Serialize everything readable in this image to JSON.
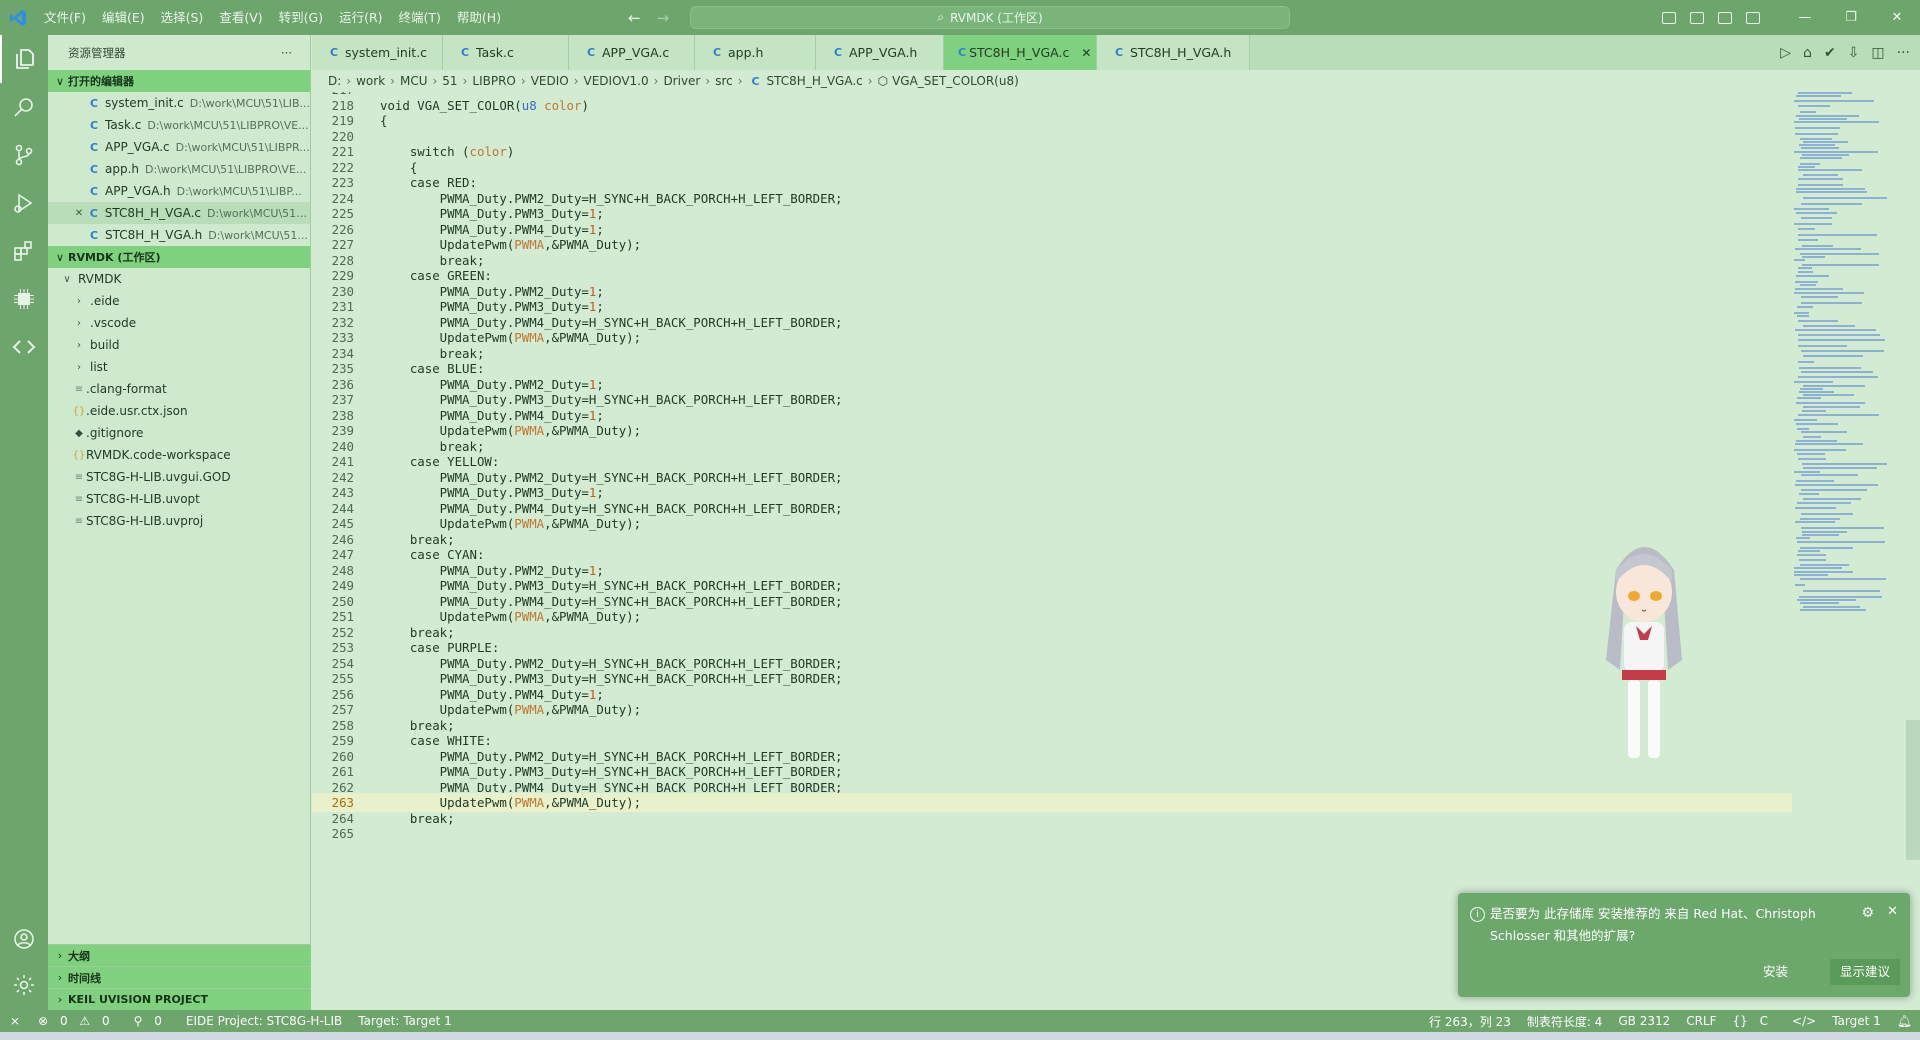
{
  "menu": [
    "文件(F)",
    "编辑(E)",
    "选择(S)",
    "查看(V)",
    "转到(G)",
    "运行(R)",
    "终端(T)",
    "帮助(H)"
  ],
  "command_center": "RVMDK (工作区)",
  "sidebar": {
    "title": "资源管理器",
    "more": "···",
    "open_editors_title": "打开的编辑器",
    "open_editors": [
      {
        "name": "system_init.c",
        "path": "D:\\work\\MCU\\51\\LIB..."
      },
      {
        "name": "Task.c",
        "path": "D:\\work\\MCU\\51\\LIBPRO\\VE..."
      },
      {
        "name": "APP_VGA.c",
        "path": "D:\\work\\MCU\\51\\LIBPR..."
      },
      {
        "name": "app.h",
        "path": "D:\\work\\MCU\\51\\LIBPRO\\VE..."
      },
      {
        "name": "APP_VGA.h",
        "path": "D:\\work\\MCU\\51\\LIBP..."
      },
      {
        "name": "STC8H_H_VGA.c",
        "path": "D:\\work\\MCU\\51\\..."
      },
      {
        "name": "STC8H_H_VGA.h",
        "path": "D:\\work\\MCU\\51..."
      }
    ],
    "workspace_title": "RVMDK (工作区)",
    "root": "RVMDK",
    "folders": [
      ".eide",
      ".vscode",
      "build",
      "list"
    ],
    "files": [
      ".clang-format",
      ".eide.usr.ctx.json",
      ".gitignore",
      "RVMDK.code-workspace",
      "STC8G-H-LIB.uvgui.GOD",
      "STC8G-H-LIB.uvopt",
      "STC8G-H-LIB.uvproj"
    ],
    "bottom_sections": [
      "大纲",
      "时间线",
      "KEIL UVISION PROJECT"
    ]
  },
  "tabs": [
    {
      "label": "system_init.c"
    },
    {
      "label": "Task.c"
    },
    {
      "label": "APP_VGA.c"
    },
    {
      "label": "app.h"
    },
    {
      "label": "APP_VGA.h"
    },
    {
      "label": "STC8H_H_VGA.c",
      "active": true
    },
    {
      "label": "STC8H_H_VGA.h"
    }
  ],
  "breadcrumb": [
    "D:",
    "work",
    "MCU",
    "51",
    "LIBPRO",
    "VEDIO",
    "VEDIOV1.0",
    "Driver",
    "src",
    "STC8H_H_VGA.c",
    "VGA_SET_COLOR(u8)"
  ],
  "editor": {
    "first_line": 217,
    "current_line": 263,
    "lines": [
      "",
      "void VGA_SET_COLOR(u8 color)",
      "{",
      "",
      "    switch (color)",
      "    {",
      "    case RED:",
      "        PWMA_Duty.PWM2_Duty=H_SYNC+H_BACK_PORCH+H_LEFT_BORDER;",
      "        PWMA_Duty.PWM3_Duty=1;",
      "        PWMA_Duty.PWM4_Duty=1;",
      "        UpdatePwm(PWMA,&PWMA_Duty);",
      "        break;",
      "    case GREEN:",
      "        PWMA_Duty.PWM2_Duty=1;",
      "        PWMA_Duty.PWM3_Duty=1;",
      "        PWMA_Duty.PWM4_Duty=H_SYNC+H_BACK_PORCH+H_LEFT_BORDER;",
      "        UpdatePwm(PWMA,&PWMA_Duty);",
      "        break;",
      "    case BLUE:",
      "        PWMA_Duty.PWM2_Duty=1;",
      "        PWMA_Duty.PWM3_Duty=H_SYNC+H_BACK_PORCH+H_LEFT_BORDER;",
      "        PWMA_Duty.PWM4_Duty=1;",
      "        UpdatePwm(PWMA,&PWMA_Duty);",
      "        break;",
      "    case YELLOW:",
      "        PWMA_Duty.PWM2_Duty=H_SYNC+H_BACK_PORCH+H_LEFT_BORDER;",
      "        PWMA_Duty.PWM3_Duty=1;",
      "        PWMA_Duty.PWM4_Duty=H_SYNC+H_BACK_PORCH+H_LEFT_BORDER;",
      "        UpdatePwm(PWMA,&PWMA_Duty);",
      "    break;",
      "    case CYAN:",
      "        PWMA_Duty.PWM2_Duty=1;",
      "        PWMA_Duty.PWM3_Duty=H_SYNC+H_BACK_PORCH+H_LEFT_BORDER;",
      "        PWMA_Duty.PWM4_Duty=H_SYNC+H_BACK_PORCH+H_LEFT_BORDER;",
      "        UpdatePwm(PWMA,&PWMA_Duty);",
      "    break;",
      "    case PURPLE:",
      "        PWMA_Duty.PWM2_Duty=H_SYNC+H_BACK_PORCH+H_LEFT_BORDER;",
      "        PWMA_Duty.PWM3_Duty=H_SYNC+H_BACK_PORCH+H_LEFT_BORDER;",
      "        PWMA_Duty.PWM4_Duty=1;",
      "        UpdatePwm(PWMA,&PWMA_Duty);",
      "    break;",
      "    case WHITE:",
      "        PWMA_Duty.PWM2_Duty=H_SYNC+H_BACK_PORCH+H_LEFT_BORDER;",
      "        PWMA_Duty.PWM3_Duty=H_SYNC+H_BACK_PORCH+H_LEFT_BORDER;",
      "        PWMA_Duty.PWM4_Duty=H_SYNC+H_BACK_PORCH+H_LEFT_BORDER;",
      "        UpdatePwm(PWMA,&PWMA_Duty);",
      "    break;",
      ""
    ]
  },
  "notification": {
    "message": "是否要为 此存储库 安装推荐的 来自 Red Hat、Christoph Schlosser 和其他的扩展?",
    "install": "安装",
    "show": "显示建议"
  },
  "status": {
    "errors": "0",
    "warnings": "0",
    "ports": "0",
    "project": "EIDE Project: STC8G-H-LIB",
    "target": "Target: Target 1",
    "position": "行 263，列 23",
    "tab_size": "制表符长度: 4",
    "encoding": "GB 2312",
    "eol": "CRLF",
    "language": "C",
    "target_right": "Target 1"
  },
  "colors": {
    "accent": "#6da56d",
    "sidebar_section": "#7fd07f",
    "editor_bg": "#d3ead3"
  }
}
